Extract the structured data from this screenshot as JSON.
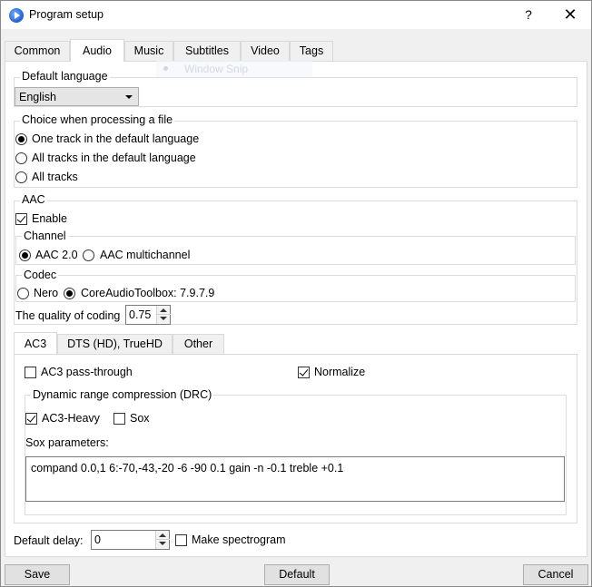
{
  "window": {
    "title": "Program setup",
    "help_glyph": "?",
    "close_glyph": "✕"
  },
  "tabs": [
    "Common",
    "Audio",
    "Music",
    "Subtitles",
    "Video",
    "Tags"
  ],
  "overlay": {
    "snip_text": "Window Snip"
  },
  "default_language": {
    "title": "Default language",
    "selected": "English"
  },
  "processing": {
    "title": "Choice when processing a file",
    "options": [
      "One track in the default language",
      "All tracks in the default language",
      "All tracks"
    ],
    "selected_index": 0
  },
  "aac": {
    "title": "AAC",
    "enable_label": "Enable",
    "enable_checked": true,
    "channel": {
      "title": "Channel",
      "options": [
        "AAC 2.0",
        "AAC multichannel"
      ],
      "selected_index": 0
    },
    "codec": {
      "title": "Codec",
      "options": [
        "Nero",
        "CoreAudioToolbox: 7.9.7.9"
      ],
      "selected_index": 1
    },
    "quality_label": "The quality of coding",
    "quality_value": "0.75"
  },
  "inner_tabs": [
    "AC3",
    "DTS (HD), TrueHD",
    "Other"
  ],
  "ac3": {
    "passthrough_label": "AC3 pass-through",
    "passthrough_checked": false,
    "normalize_label": "Normalize",
    "normalize_checked": true,
    "drc": {
      "title": "Dynamic range compression (DRC)",
      "heavy_label": "AC3-Heavy",
      "heavy_checked": true,
      "sox_label": "Sox",
      "sox_checked": false,
      "sox_params_label": "Sox parameters:",
      "sox_params_value": "compand 0.0,1 6:-70,-43,-20 -6 -90 0.1 gain -n -0.1 treble +0.1"
    }
  },
  "default_delay": {
    "label": "Default delay:",
    "value": "0"
  },
  "spectrogram": {
    "label": "Make spectrogram",
    "checked": false
  },
  "buttons": {
    "save": "Save",
    "default": "Default",
    "cancel": "Cancel"
  }
}
